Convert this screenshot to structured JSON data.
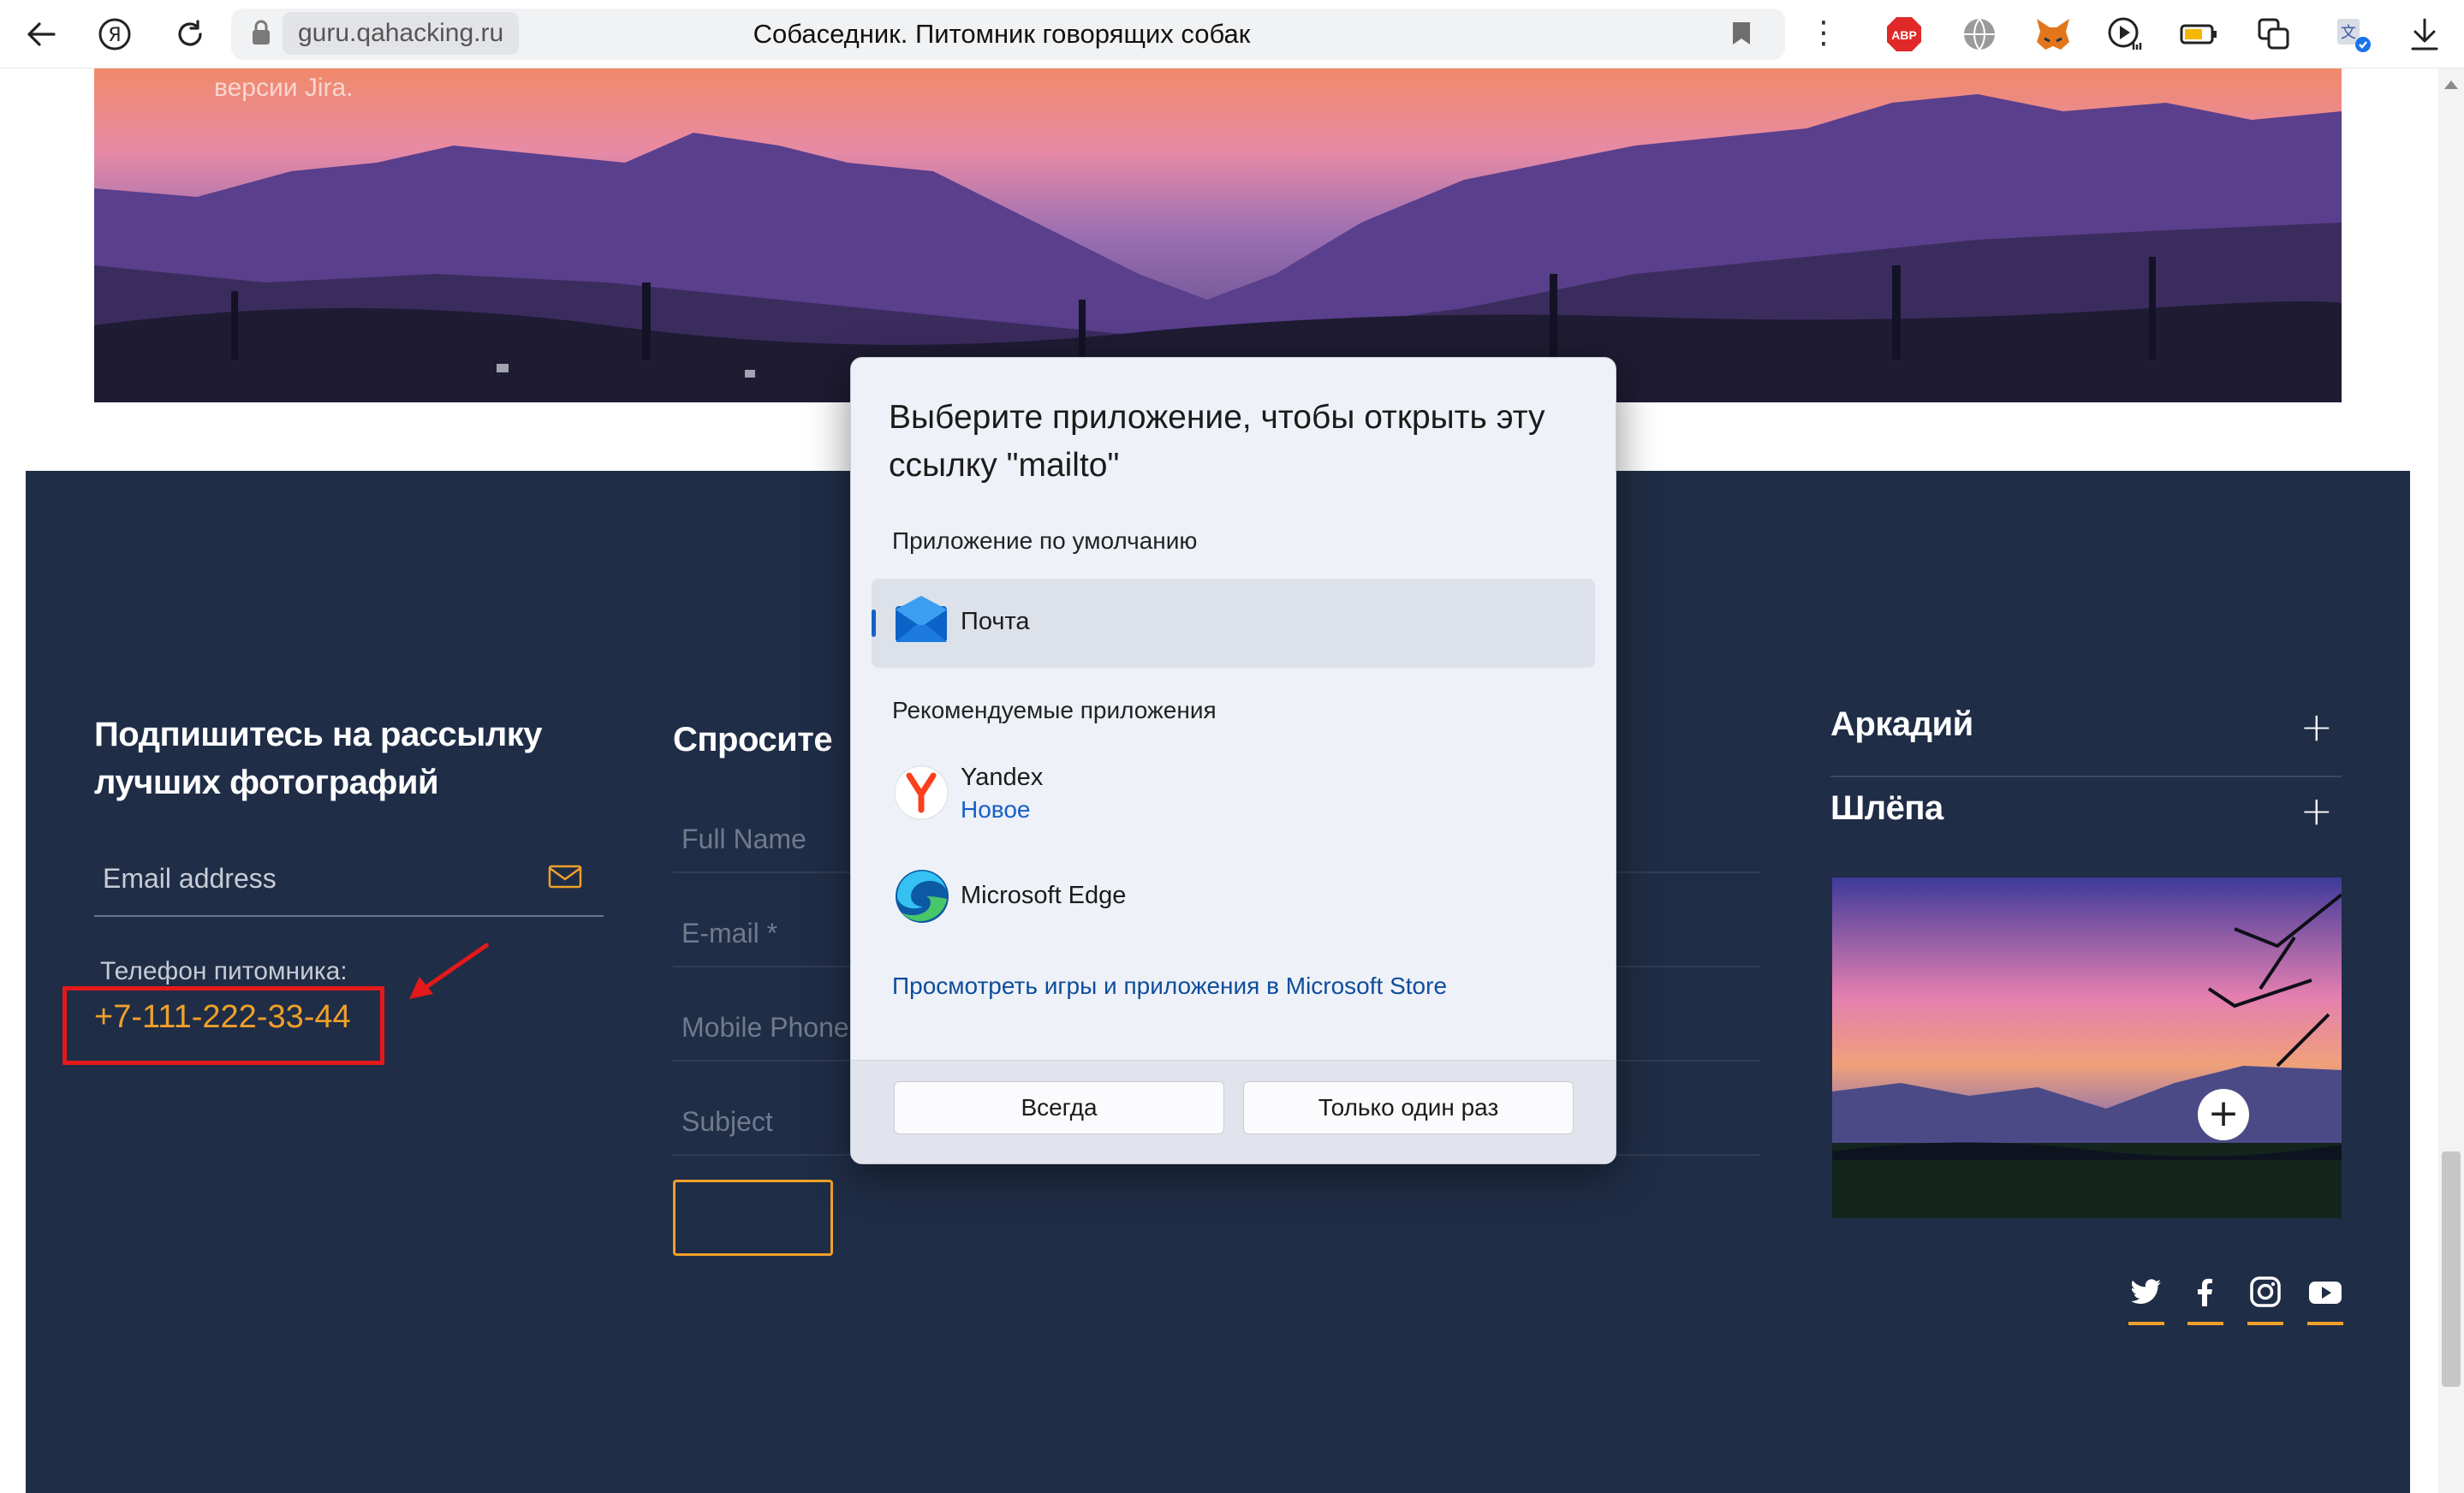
{
  "browser": {
    "domain": "guru.qahacking.ru",
    "page_title": "Собаседник. Питомник говорящих собак",
    "extensions": [
      "abp-icon",
      "globe-icon",
      "metamask-fox-icon",
      "media-player-icon",
      "battery-icon",
      "screenshot-icon",
      "translate-icon"
    ],
    "abp_label": "ABP"
  },
  "hero": {
    "caption": "версии Jira."
  },
  "subscribe": {
    "title": "Подпишитесь на рассылку лучших фотографий",
    "email_placeholder": "Email address",
    "phone_label": "Телефон питомника:",
    "phone": "+7-111-222-33-44"
  },
  "contact_form": {
    "title": "Спросите",
    "fields": [
      "Full Name",
      "E-mail *",
      "Mobile Phone",
      "Subject"
    ]
  },
  "accordion": [
    {
      "title": "Аркадий"
    },
    {
      "title": "Шлёпа"
    }
  ],
  "social": [
    "twitter-icon",
    "facebook-icon",
    "instagram-icon",
    "youtube-icon"
  ],
  "dialog": {
    "title": "Выберите приложение, чтобы открыть эту ссылку \"mailto\"",
    "default_heading": "Приложение по умолчанию",
    "default_app": "Почта",
    "recommended_heading": "Рекомендуемые приложения",
    "recommended": [
      {
        "name": "Yandex",
        "badge": "Новое"
      },
      {
        "name": "Microsoft Edge",
        "badge": ""
      }
    ],
    "store_link": "Просмотреть игры и приложения в Microsoft Store",
    "always_button": "Всегда",
    "once_button": "Только один раз"
  },
  "colors": {
    "footer_bg": "#1f2d46",
    "accent": "#f0a02a",
    "highlight_red": "#e3191b",
    "dialog_link": "#1560c9"
  }
}
